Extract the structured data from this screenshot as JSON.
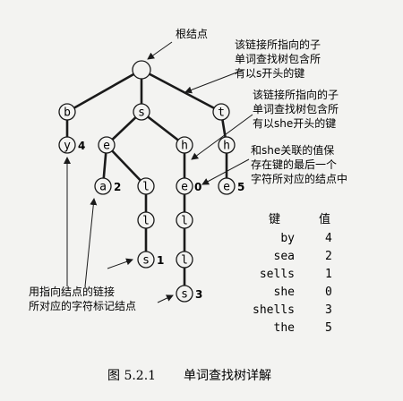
{
  "root_label": "根结点",
  "annotations": {
    "s_link": [
      "该链接所指向的子",
      "单词查找树包含所",
      "有以s开头的键"
    ],
    "she_link": [
      "该链接所指向的子",
      "单词查找树包含所",
      "有以she开头的键"
    ],
    "she_value": [
      "和she关联的值保",
      "存在键的最后一个",
      "字符所对应的结点中"
    ],
    "char_marker": [
      "用指向结点的链接",
      "所对应的字符标记结点"
    ]
  },
  "trie": {
    "nodes": [
      {
        "id": "root",
        "char": "",
        "value": ""
      },
      {
        "id": "b",
        "char": "b",
        "value": ""
      },
      {
        "id": "y",
        "char": "y",
        "value": "4"
      },
      {
        "id": "s",
        "char": "s",
        "value": ""
      },
      {
        "id": "se",
        "char": "e",
        "value": ""
      },
      {
        "id": "sea",
        "char": "a",
        "value": "2"
      },
      {
        "id": "sel",
        "char": "l",
        "value": ""
      },
      {
        "id": "sell",
        "char": "l",
        "value": ""
      },
      {
        "id": "sells",
        "char": "s",
        "value": "1"
      },
      {
        "id": "sh",
        "char": "h",
        "value": ""
      },
      {
        "id": "she",
        "char": "e",
        "value": "0"
      },
      {
        "id": "shel",
        "char": "l",
        "value": ""
      },
      {
        "id": "shell",
        "char": "l",
        "value": ""
      },
      {
        "id": "shells",
        "char": "s",
        "value": "3"
      },
      {
        "id": "t",
        "char": "t",
        "value": ""
      },
      {
        "id": "th",
        "char": "h",
        "value": ""
      },
      {
        "id": "the",
        "char": "e",
        "value": "5"
      }
    ]
  },
  "table": {
    "key_header": "键",
    "value_header": "值",
    "rows": [
      {
        "key": "by",
        "value": "4"
      },
      {
        "key": "sea",
        "value": "2"
      },
      {
        "key": "sells",
        "value": "1"
      },
      {
        "key": "she",
        "value": "0"
      },
      {
        "key": "shells",
        "value": "3"
      },
      {
        "key": "the",
        "value": "5"
      }
    ]
  },
  "caption": {
    "number": "图 5.2.1",
    "title": "单词查找树详解"
  }
}
